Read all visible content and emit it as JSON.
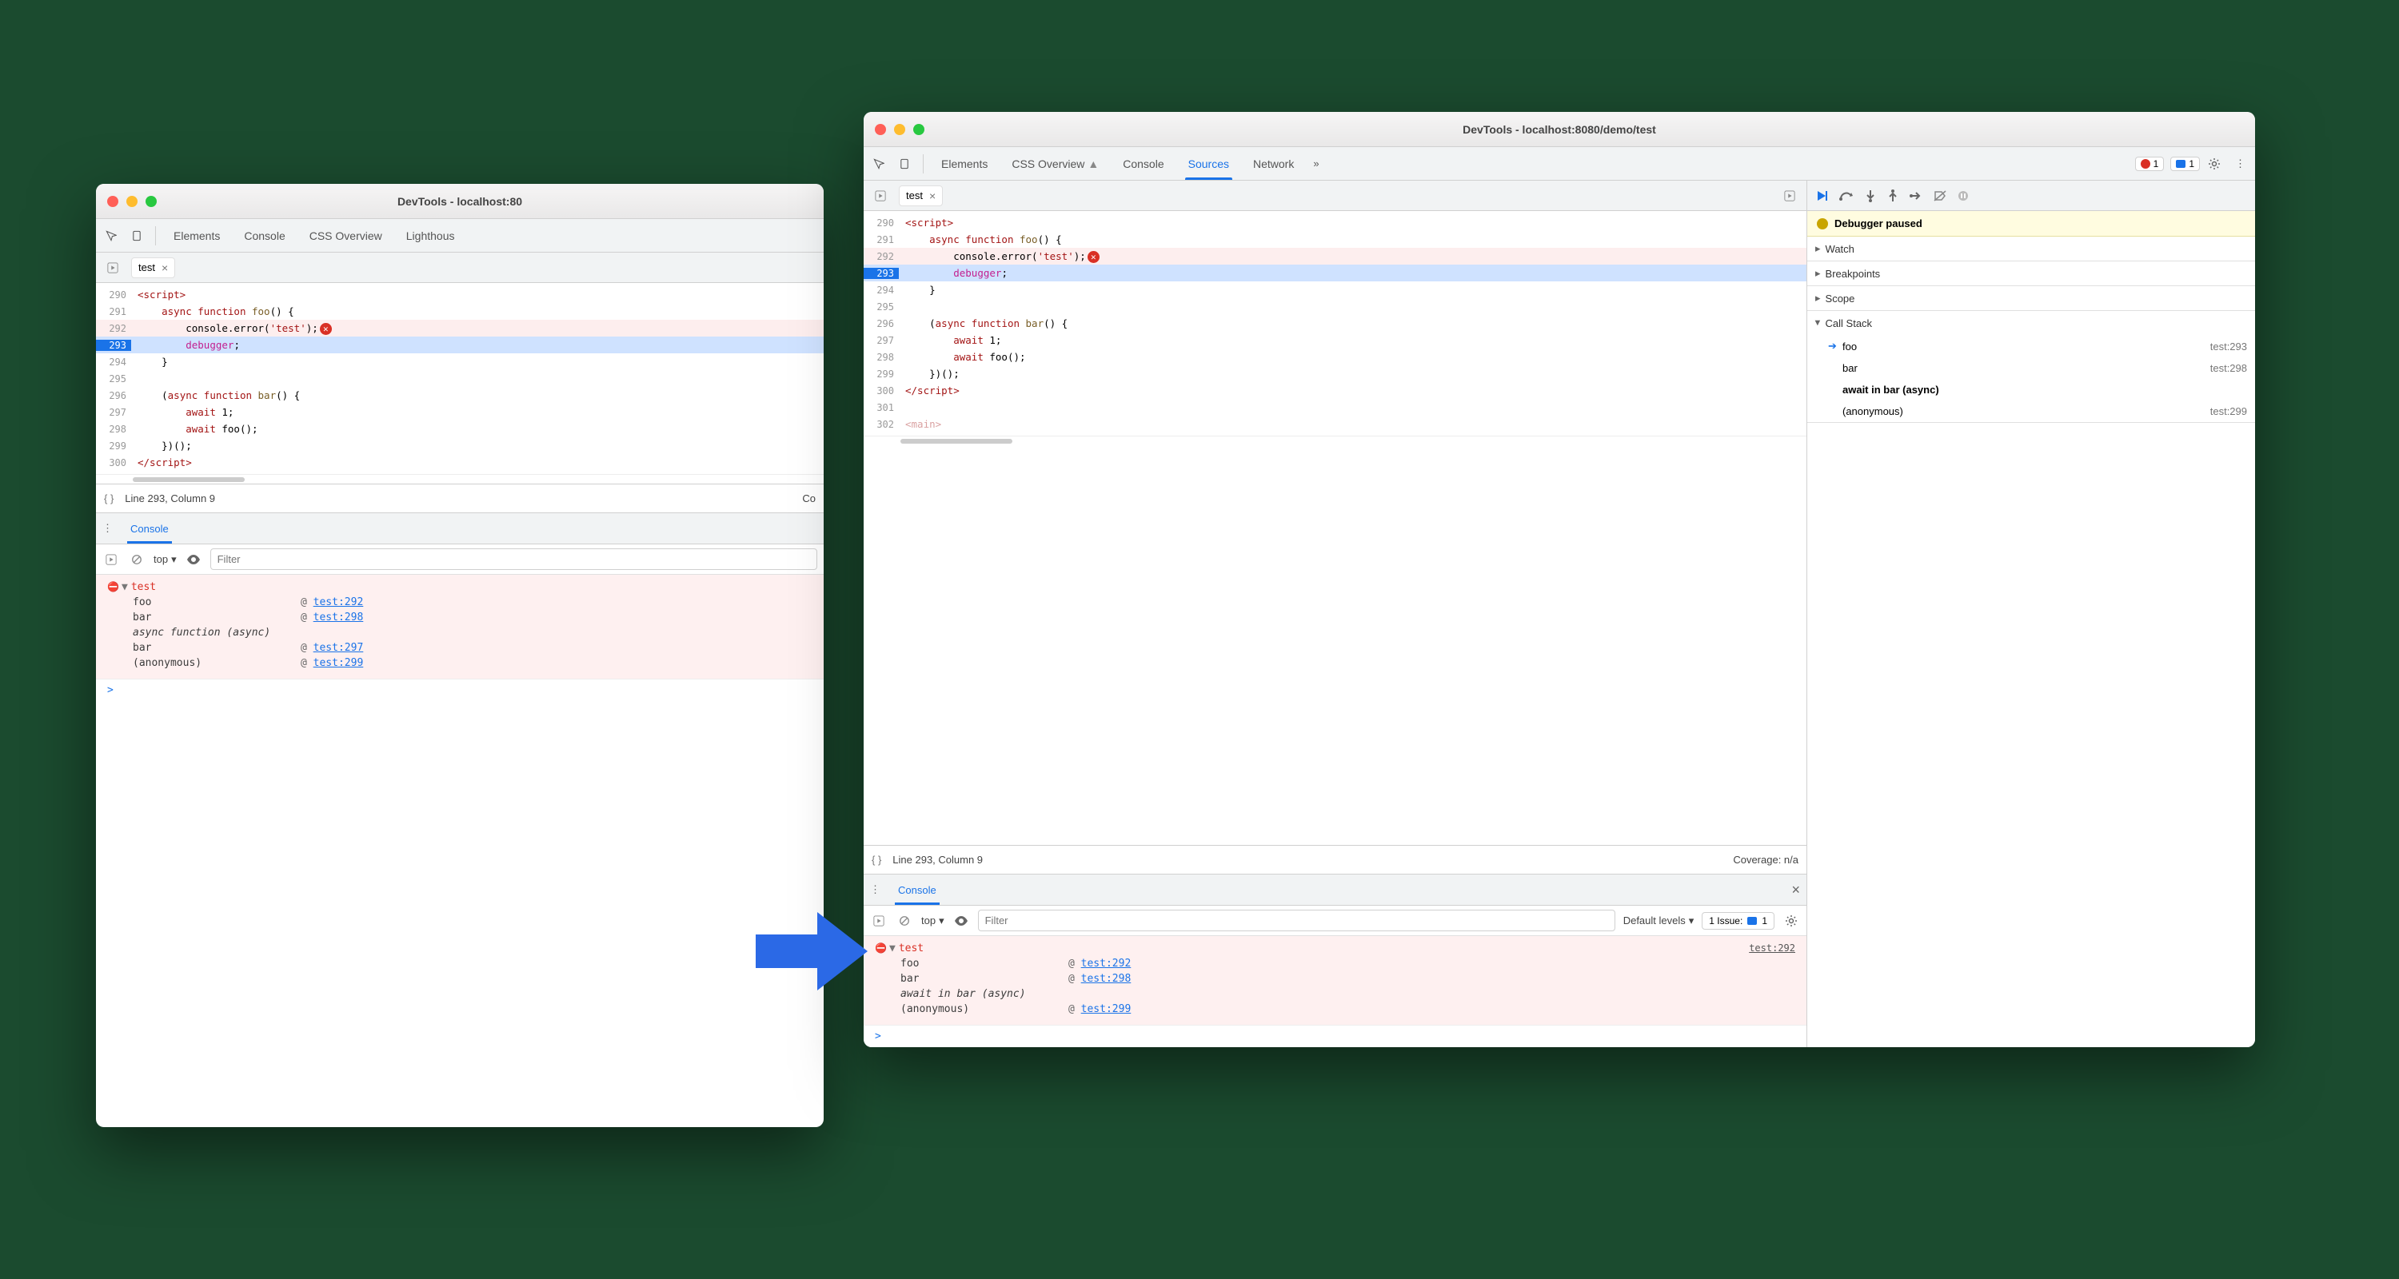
{
  "left": {
    "title": "DevTools - localhost:80",
    "tabs": [
      "Elements",
      "Console",
      "CSS Overview",
      "Lighthous"
    ],
    "file_tab": "test",
    "code": [
      {
        "n": 290,
        "html": "<span class='t-tag'>&lt;script&gt;</span>"
      },
      {
        "n": 291,
        "html": "    <span class='t-kw'>async function</span> <span class='t-fn'>foo</span>() {"
      },
      {
        "n": 292,
        "html": "        console.error(<span class='t-str'>'test'</span>);",
        "err": true
      },
      {
        "n": 293,
        "html": "        <span class='t-debugger'>debugger</span>;",
        "hl": true
      },
      {
        "n": 294,
        "html": "    }"
      },
      {
        "n": 295,
        "html": ""
      },
      {
        "n": 296,
        "html": "    (<span class='t-kw'>async function</span> <span class='t-fn'>bar</span>() {"
      },
      {
        "n": 297,
        "html": "        <span class='t-kw'>await</span> 1;"
      },
      {
        "n": 298,
        "html": "        <span class='t-kw'>await</span> foo();"
      },
      {
        "n": 299,
        "html": "    })();"
      },
      {
        "n": 300,
        "html": "<span class='t-tag'>&lt;/script&gt;</span>"
      }
    ],
    "status": "Line 293, Column 9",
    "status_right": "Co",
    "console_tab": "Console",
    "context": "top",
    "filter_placeholder": "Filter",
    "error_msg": "test",
    "stack": [
      {
        "name": "foo",
        "loc": "test:292"
      },
      {
        "name": "bar",
        "loc": "test:298"
      },
      {
        "name": "async function (async)",
        "italic": true
      },
      {
        "name": "bar",
        "loc": "test:297"
      },
      {
        "name": "(anonymous)",
        "loc": "test:299"
      }
    ]
  },
  "right": {
    "title": "DevTools - localhost:8080/demo/test",
    "tabs": [
      "Elements",
      "CSS Overview",
      "Console",
      "Sources",
      "Network"
    ],
    "active_tab": "Sources",
    "err_count": "1",
    "issue_count": "1",
    "file_tab": "test",
    "code": [
      {
        "n": 290,
        "html": "<span class='t-tag'>&lt;script&gt;</span>"
      },
      {
        "n": 291,
        "html": "    <span class='t-kw'>async function</span> <span class='t-fn'>foo</span>() {"
      },
      {
        "n": 292,
        "html": "        console.error(<span class='t-str'>'test'</span>);",
        "err": true
      },
      {
        "n": 293,
        "html": "        <span class='t-debugger'>debugger</span>;",
        "hl": true
      },
      {
        "n": 294,
        "html": "    }"
      },
      {
        "n": 295,
        "html": ""
      },
      {
        "n": 296,
        "html": "    (<span class='t-kw'>async function</span> <span class='t-fn'>bar</span>() {"
      },
      {
        "n": 297,
        "html": "        <span class='t-kw'>await</span> 1;"
      },
      {
        "n": 298,
        "html": "        <span class='t-kw'>await</span> foo();"
      },
      {
        "n": 299,
        "html": "    })();"
      },
      {
        "n": 300,
        "html": "<span class='t-tag'>&lt;/script&gt;</span>"
      },
      {
        "n": 301,
        "html": ""
      },
      {
        "n": 302,
        "html": "<span class='t-tag' style='opacity:.4'>&lt;main&gt;</span>"
      }
    ],
    "status": "Line 293, Column 9",
    "coverage": "Coverage: n/a",
    "paused": "Debugger paused",
    "sections": {
      "watch": "Watch",
      "breakpoints": "Breakpoints",
      "scope": "Scope",
      "callstack": "Call Stack"
    },
    "callstack": [
      {
        "name": "foo",
        "loc": "test:293",
        "ptr": true
      },
      {
        "name": "bar",
        "loc": "test:298"
      },
      {
        "name": "await in bar (async)",
        "bold": true
      },
      {
        "name": "(anonymous)",
        "loc": "test:299"
      }
    ],
    "console_tab": "Console",
    "context": "top",
    "filter_placeholder": "Filter",
    "levels": "Default levels",
    "issue_label": "1 Issue:",
    "issue_badge": "1",
    "error_msg": "test",
    "error_source": "test:292",
    "stack": [
      {
        "name": "foo",
        "loc": "test:292"
      },
      {
        "name": "bar",
        "loc": "test:298"
      },
      {
        "name": "await in bar (async)",
        "italic": true
      },
      {
        "name": "(anonymous)",
        "loc": "test:299"
      }
    ]
  }
}
